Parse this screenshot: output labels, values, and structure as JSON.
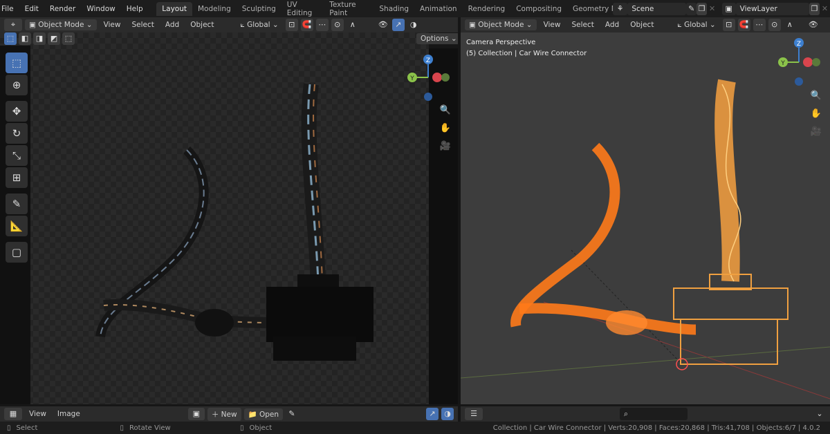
{
  "menu": [
    "File",
    "Edit",
    "Render",
    "Window",
    "Help"
  ],
  "workspaces": [
    "Layout",
    "Modeling",
    "Sculpting",
    "UV Editing",
    "Texture Paint",
    "Shading",
    "Animation",
    "Rendering",
    "Compositing",
    "Geometry Node"
  ],
  "scene": {
    "label": "Scene",
    "view_layer": "ViewLayer"
  },
  "left_header": {
    "mode": "Object Mode",
    "items": [
      "View",
      "Select",
      "Add",
      "Object"
    ],
    "orientation": "Global",
    "options": "Options"
  },
  "right_header": {
    "mode": "Object Mode",
    "items": [
      "View",
      "Select",
      "Add",
      "Object"
    ],
    "orientation": "Global"
  },
  "right_viewport": {
    "title": "Camera Perspective",
    "subtitle": "(5) Collection | Car Wire Connector"
  },
  "image_editor": {
    "items": [
      "View",
      "Image"
    ],
    "new": "New",
    "open": "Open"
  },
  "status": {
    "select": "Select",
    "rotate": "Rotate View",
    "object": "Object",
    "stats": "Collection | Car Wire Connector | Verts:20,908 | Faces:20,868 | Tris:41,708 | Objects:6/7 | 4.0.2"
  },
  "axes": {
    "x": "X",
    "y": "Y",
    "z": "Z"
  },
  "colors": {
    "accent": "#4772b3",
    "wire": "#ff7a1a",
    "x_axis": "#d9454d",
    "y_axis": "#8bc34a",
    "z_axis": "#3d7fcf"
  }
}
